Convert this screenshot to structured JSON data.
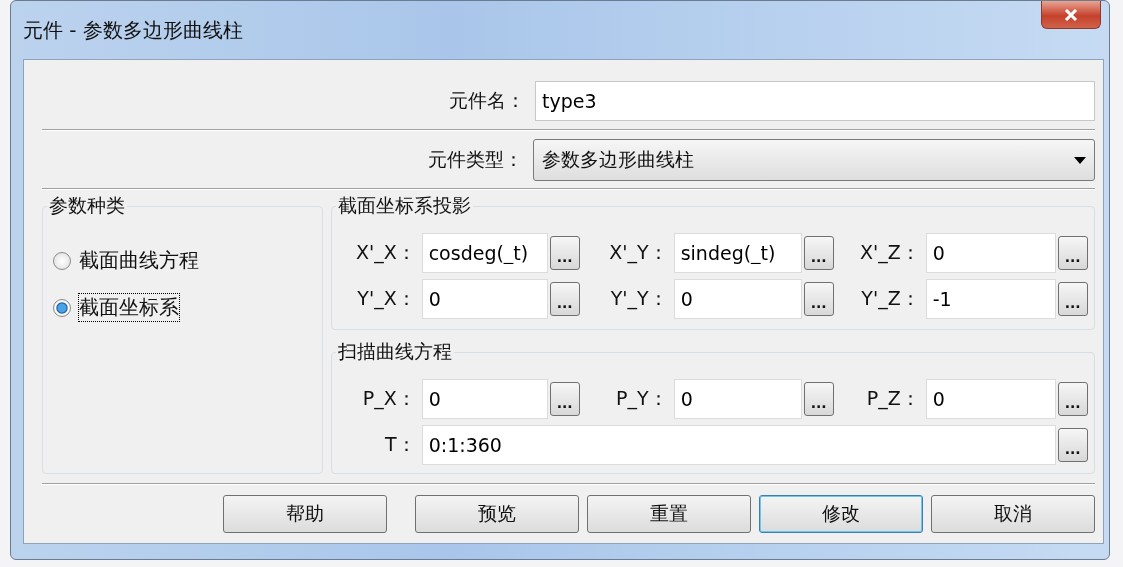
{
  "window": {
    "title": "元件 - 参数多边形曲线柱"
  },
  "name_field": {
    "label": "元件名：",
    "value": "type3"
  },
  "type_field": {
    "label": "元件类型：",
    "value": "参数多边形曲线柱"
  },
  "param_kind": {
    "title": "参数种类",
    "options": [
      {
        "label": "截面曲线方程",
        "selected": false
      },
      {
        "label": "截面坐标系",
        "selected": true
      }
    ]
  },
  "projection": {
    "title": "截面坐标系投影",
    "fields": [
      {
        "label": "X'_X：",
        "value": "cosdeg(_t)",
        "button": "..."
      },
      {
        "label": "X'_Y：",
        "value": "sindeg(_t)",
        "button": "..."
      },
      {
        "label": "X'_Z：",
        "value": "0",
        "button": "..."
      },
      {
        "label": "Y'_X：",
        "value": "0",
        "button": "..."
      },
      {
        "label": "Y'_Y：",
        "value": "0",
        "button": "..."
      },
      {
        "label": "Y'_Z：",
        "value": "-1",
        "button": "..."
      }
    ]
  },
  "sweep": {
    "title": "扫描曲线方程",
    "fields": [
      {
        "label": "P_X：",
        "value": "0",
        "button": "..."
      },
      {
        "label": "P_Y：",
        "value": "0",
        "button": "..."
      },
      {
        "label": "P_Z：",
        "value": "0",
        "button": "..."
      }
    ],
    "t_field": {
      "label": "T：",
      "value": "0:1:360",
      "button": "..."
    }
  },
  "buttons": [
    {
      "label": "帮助",
      "default": false
    },
    {
      "label": "预览",
      "default": false
    },
    {
      "label": "重置",
      "default": false
    },
    {
      "label": "修改",
      "default": true
    },
    {
      "label": "取消",
      "default": false
    }
  ]
}
